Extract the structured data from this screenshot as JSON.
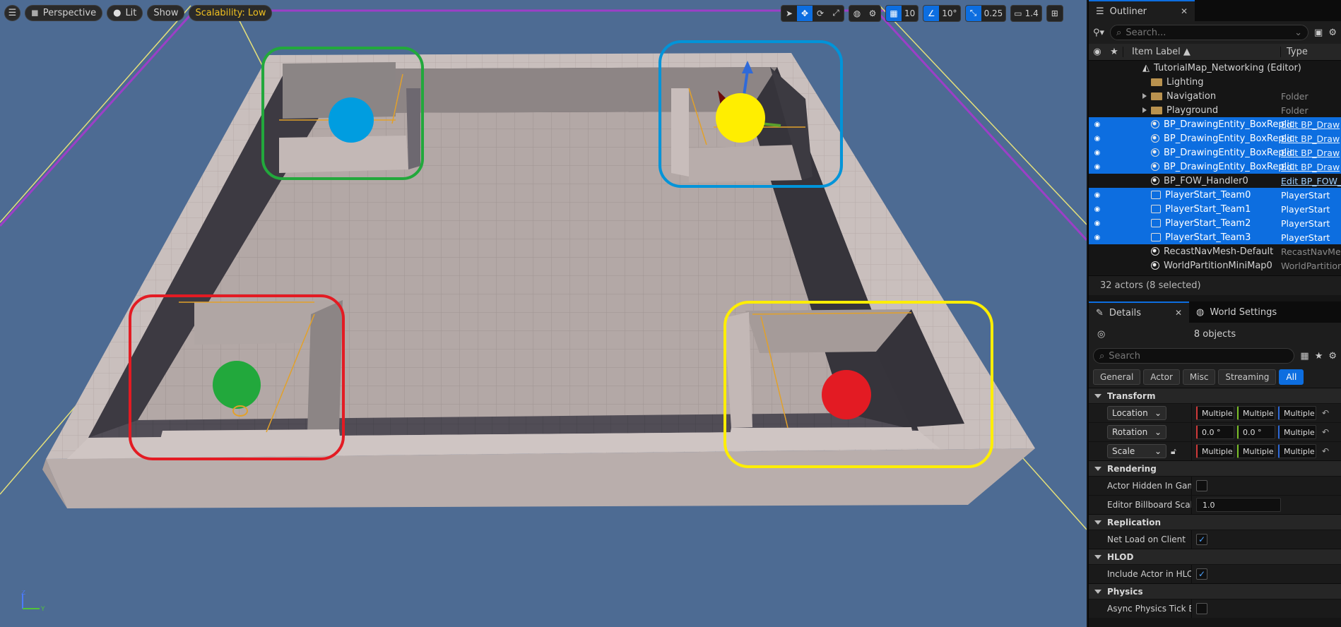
{
  "viewport": {
    "menu_icon": "hamburger-icon",
    "perspective_label": "Perspective",
    "lit_label": "Lit",
    "show_label": "Show",
    "scalability_label": "Scalability: Low",
    "grid_snap_value": "10",
    "rotation_snap_value": "10°",
    "scale_snap_value": "0.25",
    "camera_speed_value": "1.4",
    "markers": [
      {
        "color": "#e31b23",
        "team": "red"
      },
      {
        "color": "#009de0",
        "team": "blue"
      },
      {
        "color": "#ffee00",
        "team": "yellow"
      },
      {
        "color": "#22a83c",
        "team": "green"
      }
    ]
  },
  "outliner": {
    "tab_label": "Outliner",
    "search_placeholder": "Search...",
    "col_label": "Item Label ▲",
    "col_type": "Type",
    "rows": [
      {
        "label": "TutorialMap_Networking (Editor)",
        "type": "",
        "selected": false,
        "eye": false,
        "kind": "world"
      },
      {
        "label": "Lighting",
        "type": "",
        "selected": false,
        "eye": false,
        "kind": "folder"
      },
      {
        "label": "Navigation",
        "type": "Folder",
        "selected": false,
        "eye": false,
        "kind": "folder-collapsed"
      },
      {
        "label": "Playground",
        "type": "Folder",
        "selected": false,
        "eye": false,
        "kind": "folder-collapsed"
      },
      {
        "label": "BP_DrawingEntity_BoxReplic",
        "type": "Edit BP_Draw",
        "selected": true,
        "eye": true,
        "kind": "entity",
        "link": true
      },
      {
        "label": "BP_DrawingEntity_BoxReplic",
        "type": "Edit BP_Draw",
        "selected": true,
        "eye": true,
        "kind": "entity",
        "link": true
      },
      {
        "label": "BP_DrawingEntity_BoxReplic",
        "type": "Edit BP_Draw",
        "selected": true,
        "eye": true,
        "kind": "entity",
        "link": true
      },
      {
        "label": "BP_DrawingEntity_BoxReplic",
        "type": "Edit BP_Draw",
        "selected": true,
        "eye": true,
        "kind": "entity",
        "link": true
      },
      {
        "label": "BP_FOW_Handler0",
        "type": "Edit BP_FOW_",
        "selected": false,
        "eye": false,
        "kind": "entity",
        "link": true
      },
      {
        "label": "PlayerStart_Team0",
        "type": "PlayerStart",
        "selected": true,
        "eye": true,
        "kind": "playerstart"
      },
      {
        "label": "PlayerStart_Team1",
        "type": "PlayerStart",
        "selected": true,
        "eye": true,
        "kind": "playerstart"
      },
      {
        "label": "PlayerStart_Team2",
        "type": "PlayerStart",
        "selected": true,
        "eye": true,
        "kind": "playerstart"
      },
      {
        "label": "PlayerStart_Team3",
        "type": "PlayerStart",
        "selected": true,
        "eye": true,
        "kind": "playerstart"
      },
      {
        "label": "RecastNavMesh-Default",
        "type": "RecastNavMe",
        "selected": false,
        "eye": false,
        "kind": "entity"
      },
      {
        "label": "WorldPartitionMiniMap0",
        "type": "WorldPartition",
        "selected": false,
        "eye": false,
        "kind": "entity"
      }
    ],
    "status": "32 actors (8 selected)"
  },
  "details": {
    "tab_label": "Details",
    "world_tab_label": "World Settings",
    "objects_label": "8 objects",
    "search_placeholder": "Search",
    "filters": [
      "General",
      "Actor",
      "Misc",
      "Streaming",
      "All"
    ],
    "active_filter": "All",
    "transform": {
      "title": "Transform",
      "location_label": "Location",
      "rotation_label": "Rotation",
      "scale_label": "Scale",
      "location": [
        "Multiple",
        "Multiple",
        "Multiple"
      ],
      "rotation": [
        "0.0 °",
        "0.0 °",
        "Multiple"
      ],
      "scale": [
        "Multiple",
        "Multiple",
        "Multiple"
      ]
    },
    "rendering": {
      "title": "Rendering",
      "hidden_label": "Actor Hidden In Game",
      "billboard_label": "Editor Billboard Scale",
      "billboard_value": "1.0"
    },
    "replication": {
      "title": "Replication",
      "net_load_label": "Net Load on Client"
    },
    "hlod": {
      "title": "HLOD",
      "include_label": "Include Actor in HLOD"
    },
    "physics": {
      "title": "Physics",
      "async_label": "Async Physics Tick E"
    }
  }
}
